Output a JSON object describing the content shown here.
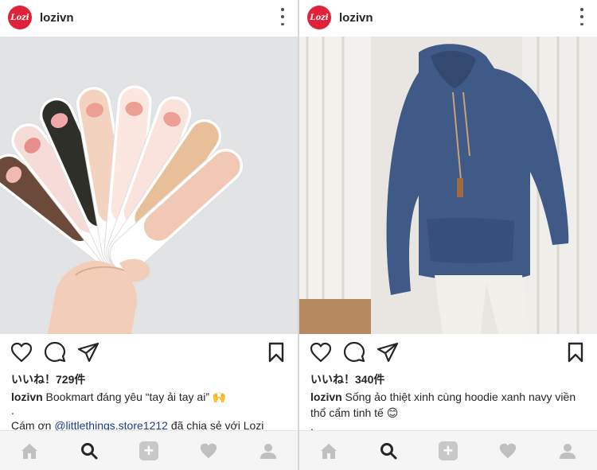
{
  "posts": [
    {
      "username": "lozivn",
      "logo_text": "Lozi",
      "likes": "いいね！729件",
      "caption_user": "lozivn",
      "caption_text": " Bookmart đáng yêu “tay ải tay ai” 🙌",
      "dot": ".",
      "thanks_prefix": "Cám ơn ",
      "thanks_link": "@littlethings.store1212",
      "thanks_suffix": " đã chia sẻ với Lozi"
    },
    {
      "username": "lozivn",
      "logo_text": "Lozi",
      "likes": "いいね！340件",
      "caption_user": "lozivn",
      "caption_text": " Sống ảo thiệt xinh cùng hoodie xanh navy viền thổ cẩm tinh tế 😊",
      "dot": "."
    }
  ],
  "icons": [
    "more-vertical-icon",
    "heart-icon",
    "comment-icon",
    "share-icon",
    "bookmark-icon",
    "home-icon",
    "search-icon",
    "add-icon",
    "activity-heart-icon",
    "profile-icon"
  ],
  "colors": {
    "brand": "#e0213a",
    "link": "#1f3a8a",
    "tabbar": "#f5f5f5"
  }
}
